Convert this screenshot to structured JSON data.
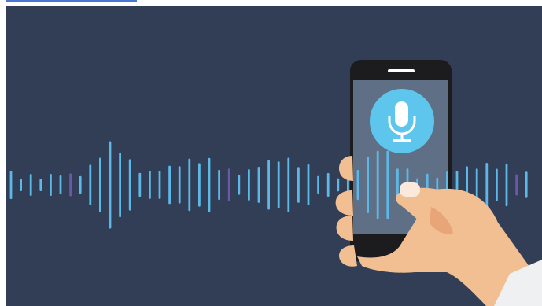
{
  "illustration": {
    "subject": "voice-assistant",
    "icon": "microphone-icon",
    "colors": {
      "background": "#323e55",
      "wave": "#5cb8e6",
      "wave_dim": "#6a58a8",
      "phone_body": "#1c1c1e",
      "phone_screen": "#5e6f86",
      "mic_circle": "#5ec6ec",
      "mic_glyph": "#ffffff",
      "skin": "#f2bf92",
      "skin_shade": "#e8a678",
      "sleeve": "#eef0f2",
      "link_bar": "#4a77d4"
    }
  }
}
